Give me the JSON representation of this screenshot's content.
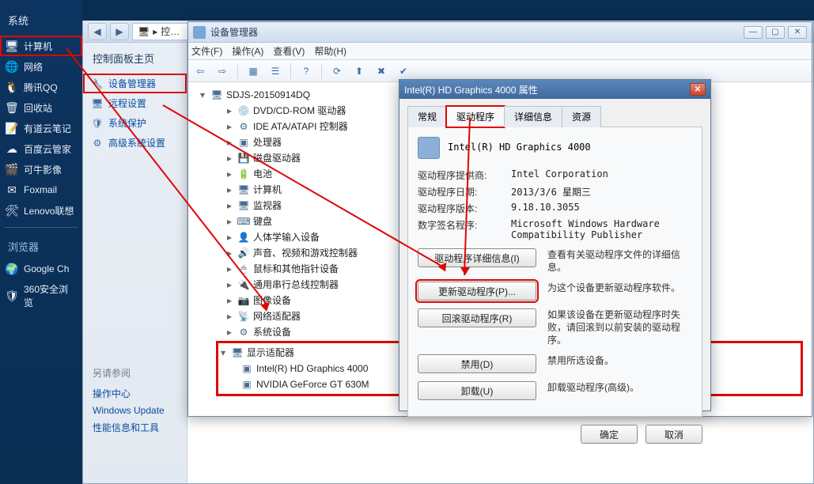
{
  "desktop": {
    "section1": "系统",
    "items1": [
      {
        "ico": "🖥",
        "label": "计算机",
        "hl": true
      },
      {
        "ico": "🌐",
        "label": "网络"
      },
      {
        "ico": "🐧",
        "label": "腾讯QQ"
      },
      {
        "ico": "🗑",
        "label": "回收站"
      },
      {
        "ico": "📝",
        "label": "有道云笔记"
      },
      {
        "ico": "☁",
        "label": "百度云管家"
      },
      {
        "ico": "🎬",
        "label": "可牛影像"
      },
      {
        "ico": "✉",
        "label": "Foxmail"
      },
      {
        "ico": "🛠",
        "label": "Lenovo联想"
      }
    ],
    "section2": "浏览器",
    "items2": [
      {
        "ico": "🌍",
        "label": "Google Ch"
      },
      {
        "ico": "🛡",
        "label": "360安全浏览"
      }
    ]
  },
  "ctrl": {
    "breadcrumb_icon": "🖥",
    "breadcrumb": "控…",
    "nav_head": "控制面板主页",
    "nav_items": [
      {
        "ico": "🔧",
        "label": "设备管理器",
        "hl": true
      },
      {
        "ico": "🖥",
        "label": "远程设置"
      },
      {
        "ico": "🛡",
        "label": "系统保护"
      },
      {
        "ico": "⚙",
        "label": "高级系统设置"
      }
    ],
    "see_also": "另请参阅",
    "see_items": [
      "操作中心",
      "Windows Update",
      "性能信息和工具"
    ]
  },
  "devmgr": {
    "title": "设备管理器",
    "menu": [
      "文件(F)",
      "操作(A)",
      "查看(V)",
      "帮助(H)"
    ],
    "root": "SDJS-20150914DQ",
    "nodes": [
      {
        "ico": "💿",
        "label": "DVD/CD-ROM 驱动器"
      },
      {
        "ico": "⚙",
        "label": "IDE ATA/ATAPI 控制器"
      },
      {
        "ico": "▣",
        "label": "处理器"
      },
      {
        "ico": "💾",
        "label": "磁盘驱动器"
      },
      {
        "ico": "🔋",
        "label": "电池"
      },
      {
        "ico": "🖥",
        "label": "计算机"
      },
      {
        "ico": "🖥",
        "label": "监视器"
      },
      {
        "ico": "⌨",
        "label": "键盘"
      },
      {
        "ico": "👤",
        "label": "人体学输入设备"
      },
      {
        "ico": "🔊",
        "label": "声音、视频和游戏控制器"
      },
      {
        "ico": "🖱",
        "label": "鼠标和其他指针设备"
      },
      {
        "ico": "🔌",
        "label": "通用串行总线控制器"
      },
      {
        "ico": "📷",
        "label": "图像设备"
      },
      {
        "ico": "📡",
        "label": "网络适配器"
      },
      {
        "ico": "⚙",
        "label": "系统设备"
      }
    ],
    "display_label": "显示适配器",
    "display_children": [
      "Intel(R) HD Graphics 4000",
      "NVIDIA GeForce GT 630M"
    ]
  },
  "props": {
    "title": "Intel(R) HD Graphics 4000 属性",
    "tabs": [
      "常规",
      "驱动程序",
      "详细信息",
      "资源"
    ],
    "device_name": "Intel(R) HD Graphics 4000",
    "kv": [
      {
        "k": "驱动程序提供商:",
        "v": "Intel Corporation"
      },
      {
        "k": "驱动程序日期:",
        "v": "2013/3/6 星期三"
      },
      {
        "k": "驱动程序版本:",
        "v": "9.18.10.3055"
      },
      {
        "k": "数字签名程序:",
        "v": "Microsoft Windows Hardware Compatibility Publisher"
      }
    ],
    "buttons": [
      {
        "label": "驱动程序详细信息(I)",
        "desc": "查看有关驱动程序文件的详细信息。",
        "hl": false
      },
      {
        "label": "更新驱动程序(P)...",
        "desc": "为这个设备更新驱动程序软件。",
        "hl": true
      },
      {
        "label": "回滚驱动程序(R)",
        "desc": "如果该设备在更新驱动程序时失败，请回滚到以前安装的驱动程序。",
        "hl": false
      },
      {
        "label": "禁用(D)",
        "desc": "禁用所选设备。",
        "hl": false
      },
      {
        "label": "卸载(U)",
        "desc": "卸载驱动程序(高级)。",
        "hl": false
      }
    ],
    "ok": "确定",
    "cancel": "取消"
  }
}
